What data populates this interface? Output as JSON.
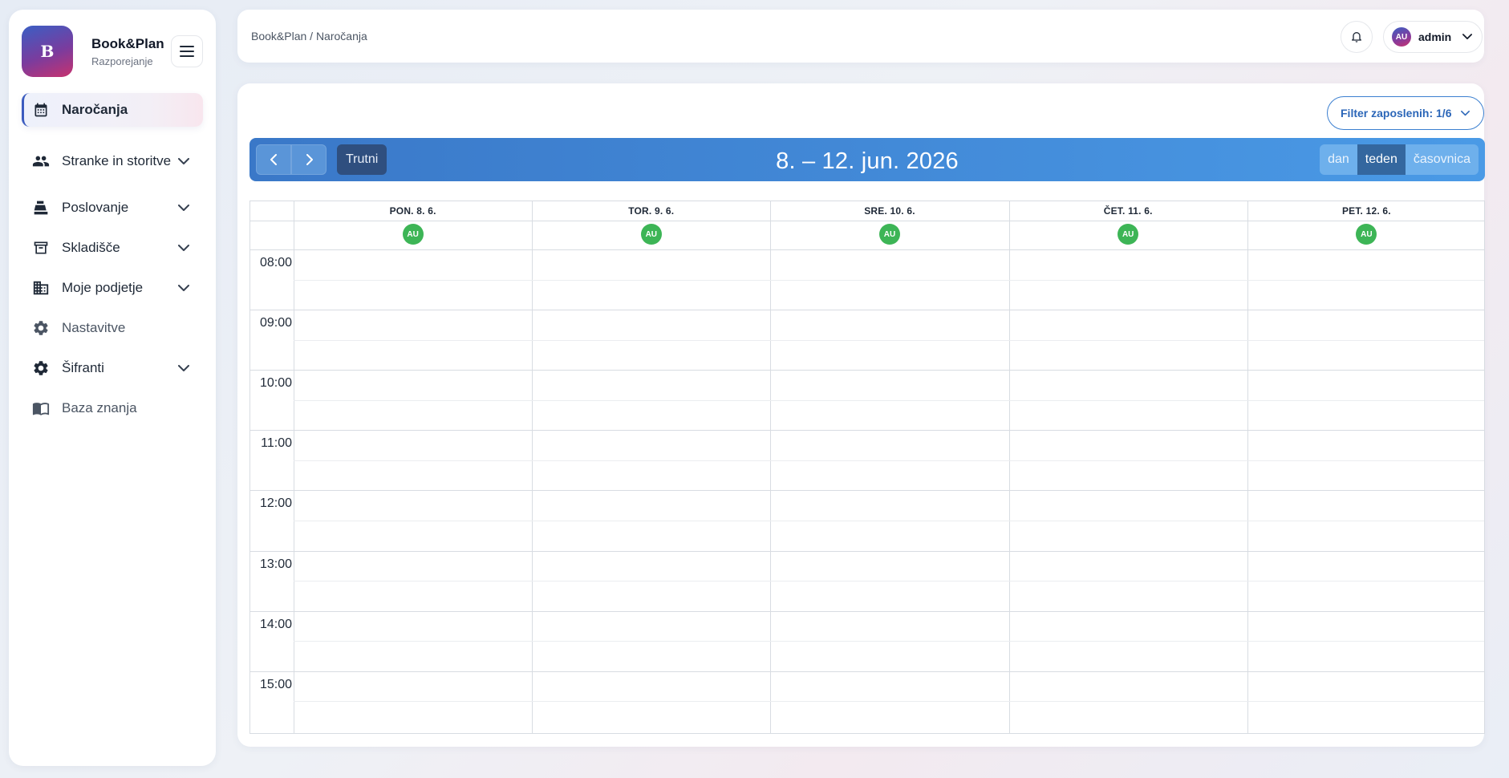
{
  "brand": {
    "logo_letter": "B",
    "name": "Book&Plan",
    "subtitle": "Razporejanje"
  },
  "sidebar": {
    "items": [
      {
        "label": "Naročanja",
        "icon": "calendar-icon",
        "active": true
      },
      {
        "label": "Stranke in storitve",
        "icon": "people-icon",
        "expandable": true
      },
      {
        "label": "Poslovanje",
        "icon": "cash-register-icon",
        "expandable": true
      },
      {
        "label": "Skladišče",
        "icon": "archive-box-icon",
        "expandable": true
      },
      {
        "label": "Moje podjetje",
        "icon": "building-icon",
        "expandable": true
      },
      {
        "label": "Nastavitve",
        "icon": "gear-icon"
      },
      {
        "label": "Šifranti",
        "icon": "gear-icon",
        "expandable": true
      },
      {
        "label": "Baza znanja",
        "icon": "book-icon"
      }
    ]
  },
  "topbar": {
    "breadcrumb": "Book&Plan / Naročanja",
    "user": {
      "initials": "AU",
      "name": "admin"
    }
  },
  "calendar": {
    "filter_label": "Filter zaposlenih: 1/6",
    "today_label": "Trutni",
    "title": "8. – 12. jun. 2026",
    "views": [
      {
        "label": "dan",
        "active": false
      },
      {
        "label": "teden",
        "active": true
      },
      {
        "label": "časovnica",
        "active": false
      }
    ],
    "days": [
      {
        "label": "PON. 8. 6.",
        "employee": "AU"
      },
      {
        "label": "TOR. 9. 6.",
        "employee": "AU"
      },
      {
        "label": "SRE. 10. 6.",
        "employee": "AU"
      },
      {
        "label": "ČET. 11. 6.",
        "employee": "AU"
      },
      {
        "label": "PET. 12. 6.",
        "employee": "AU"
      }
    ],
    "hours": [
      "08:00",
      "09:00",
      "10:00",
      "11:00",
      "12:00",
      "13:00",
      "14:00",
      "15:00"
    ]
  },
  "colors": {
    "accent": "#3a78c8",
    "badge": "#3db556",
    "active_view": "#34679f"
  }
}
